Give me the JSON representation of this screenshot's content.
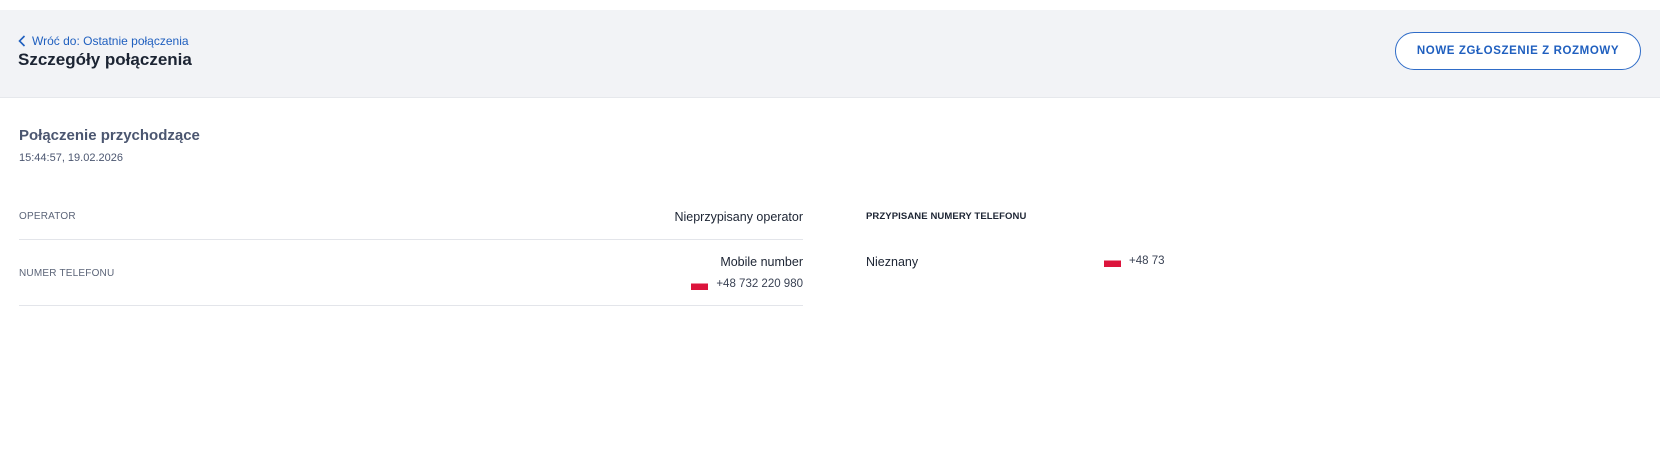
{
  "header": {
    "back_link": "Wróć do: Ostatnie połączenia",
    "title": "Szczegóły połączenia",
    "new_ticket_button": "NOWE ZGŁOSZENIE Z ROZMOWY"
  },
  "call": {
    "type": "Połączenie przychodzące",
    "datetime": "15:44:57, 19.02.2026"
  },
  "details": {
    "operator_label": "OPERATOR",
    "operator_value": "Nieprzypisany operator",
    "phone_label": "NUMER TELEFONU",
    "phone_type": "Mobile number",
    "phone_number": "+48 732 220 980",
    "phone_flag": "poland-flag-icon"
  },
  "assigned": {
    "title": "PRZYPISANE NUMERY TELEFONU",
    "items": [
      {
        "status": "Nieznany",
        "number": "+48 73",
        "flag": "poland-flag-icon"
      }
    ]
  },
  "colors": {
    "accent": "#1f5fbf",
    "header_bg": "#f2f3f6",
    "flag_red": "#dc143c"
  }
}
